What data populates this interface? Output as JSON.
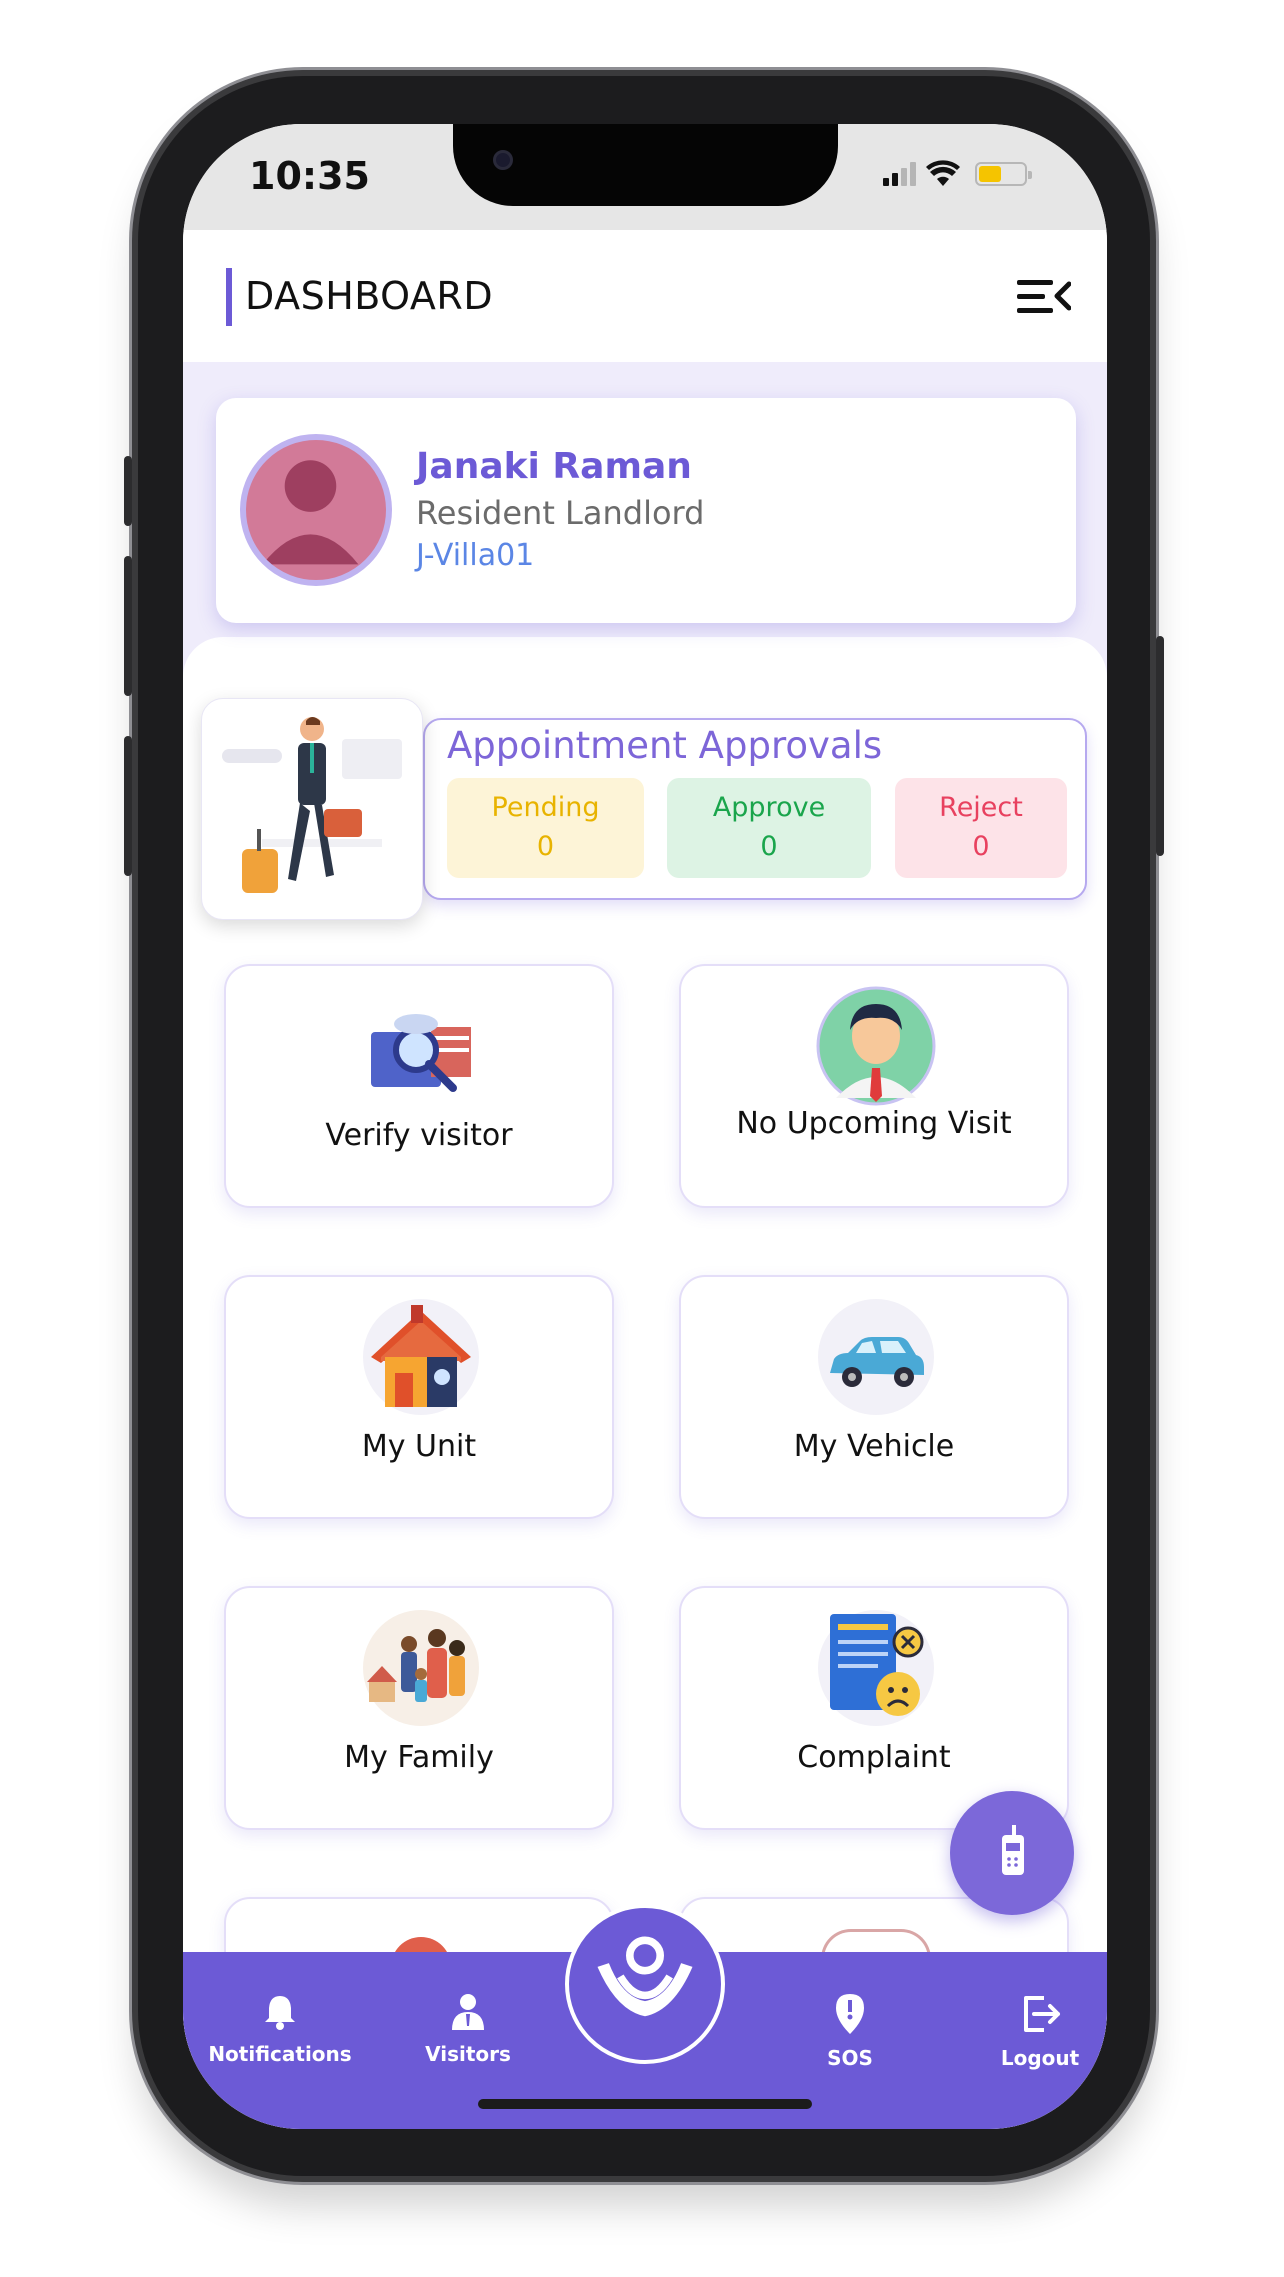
{
  "status_bar": {
    "time": "10:35"
  },
  "header": {
    "title": "DASHBOARD"
  },
  "profile": {
    "name": "Janaki Raman",
    "role": "Resident Landlord",
    "unit": "J-Villa01"
  },
  "appointments": {
    "title": "Appointment Approvals",
    "pending": {
      "label": "Pending",
      "value": "0",
      "bg": "#fdf4d7",
      "color": "#e8b300"
    },
    "approve": {
      "label": "Approve",
      "value": "0",
      "bg": "#ddf3e4",
      "color": "#1aa54c"
    },
    "reject": {
      "label": "Reject",
      "value": "0",
      "bg": "#fde3e8",
      "color": "#e8415f"
    }
  },
  "tiles": [
    {
      "label": "Verify visitor",
      "icon": "verify-visitor-icon"
    },
    {
      "label": "No Upcoming Visit",
      "icon": "visitor-avatar-icon"
    },
    {
      "label": "My Unit",
      "icon": "house-icon"
    },
    {
      "label": "My Vehicle",
      "icon": "car-icon"
    },
    {
      "label": "My Family",
      "icon": "family-icon"
    },
    {
      "label": "Complaint",
      "icon": "complaint-icon"
    }
  ],
  "bottom_nav": {
    "notifications": "Notifications",
    "visitors": "Visitors",
    "sos": "SOS",
    "logout": "Logout"
  },
  "colors": {
    "accent": "#6c5ad6",
    "accent_light": "#efecfb"
  }
}
